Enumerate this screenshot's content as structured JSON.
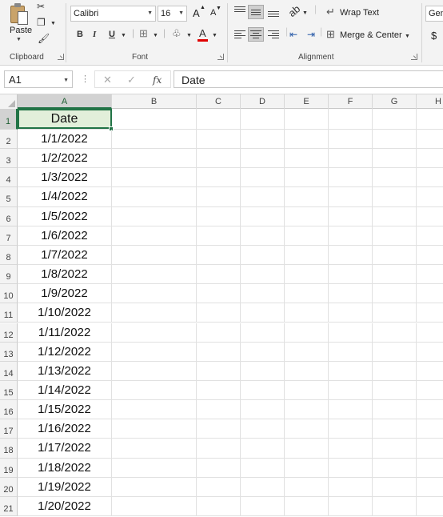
{
  "ribbon": {
    "clipboard": {
      "paste_label": "Paste",
      "group_label": "Clipboard"
    },
    "font": {
      "font_name": "Calibri",
      "font_size": "16",
      "group_label": "Font",
      "bold": "B",
      "italic": "I",
      "underline": "U",
      "grow": "A",
      "shrink": "A",
      "font_color_letter": "A",
      "font_color": "#e00000"
    },
    "alignment": {
      "wrap_text": "Wrap Text",
      "merge_center": "Merge & Center",
      "group_label": "Alignment"
    },
    "number": {
      "format": "Gen",
      "currency": "$"
    }
  },
  "formula_bar": {
    "name_box": "A1",
    "fx": "fx",
    "value": "Date"
  },
  "grid": {
    "columns": [
      "A",
      "B",
      "C",
      "D",
      "E",
      "F",
      "G",
      "H"
    ],
    "active_column": "A",
    "active_row": "1",
    "rows": [
      {
        "num": "1",
        "a": "Date"
      },
      {
        "num": "2",
        "a": "1/1/2022"
      },
      {
        "num": "3",
        "a": "1/2/2022"
      },
      {
        "num": "4",
        "a": "1/3/2022"
      },
      {
        "num": "5",
        "a": "1/4/2022"
      },
      {
        "num": "6",
        "a": "1/5/2022"
      },
      {
        "num": "7",
        "a": "1/6/2022"
      },
      {
        "num": "8",
        "a": "1/7/2022"
      },
      {
        "num": "9",
        "a": "1/8/2022"
      },
      {
        "num": "10",
        "a": "1/9/2022"
      },
      {
        "num": "11",
        "a": "1/10/2022"
      },
      {
        "num": "12",
        "a": "1/11/2022"
      },
      {
        "num": "13",
        "a": "1/12/2022"
      },
      {
        "num": "14",
        "a": "1/13/2022"
      },
      {
        "num": "15",
        "a": "1/14/2022"
      },
      {
        "num": "16",
        "a": "1/15/2022"
      },
      {
        "num": "17",
        "a": "1/16/2022"
      },
      {
        "num": "18",
        "a": "1/17/2022"
      },
      {
        "num": "19",
        "a": "1/18/2022"
      },
      {
        "num": "20",
        "a": "1/19/2022"
      },
      {
        "num": "21",
        "a": "1/20/2022"
      }
    ]
  },
  "colors": {
    "accent": "#217346",
    "header_fill": "#e2efda"
  }
}
